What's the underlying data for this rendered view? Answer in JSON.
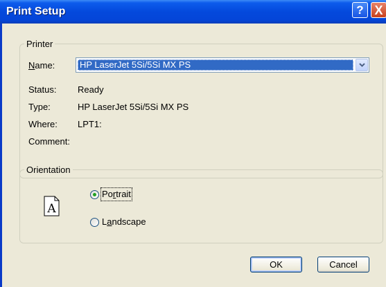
{
  "window": {
    "title": "Print Setup"
  },
  "titlebar_buttons": {
    "help": "?",
    "close": "X"
  },
  "printer_group": {
    "label": "Printer",
    "name_label": "Name:",
    "name_value": "HP LaserJet 5Si/5Si MX PS",
    "status_label": "Status:",
    "status_value": "Ready",
    "type_label": "Type:",
    "type_value": "HP LaserJet 5Si/5Si MX PS",
    "where_label": "Where:",
    "where_value": "LPT1:",
    "comment_label": "Comment:",
    "comment_value": ""
  },
  "orientation_group": {
    "label": "Orientation",
    "icon_letter": "A",
    "portrait_label": "Portrait",
    "landscape_label": "Landscape",
    "selected": "Portrait"
  },
  "buttons": {
    "ok": "OK",
    "cancel": "Cancel"
  }
}
